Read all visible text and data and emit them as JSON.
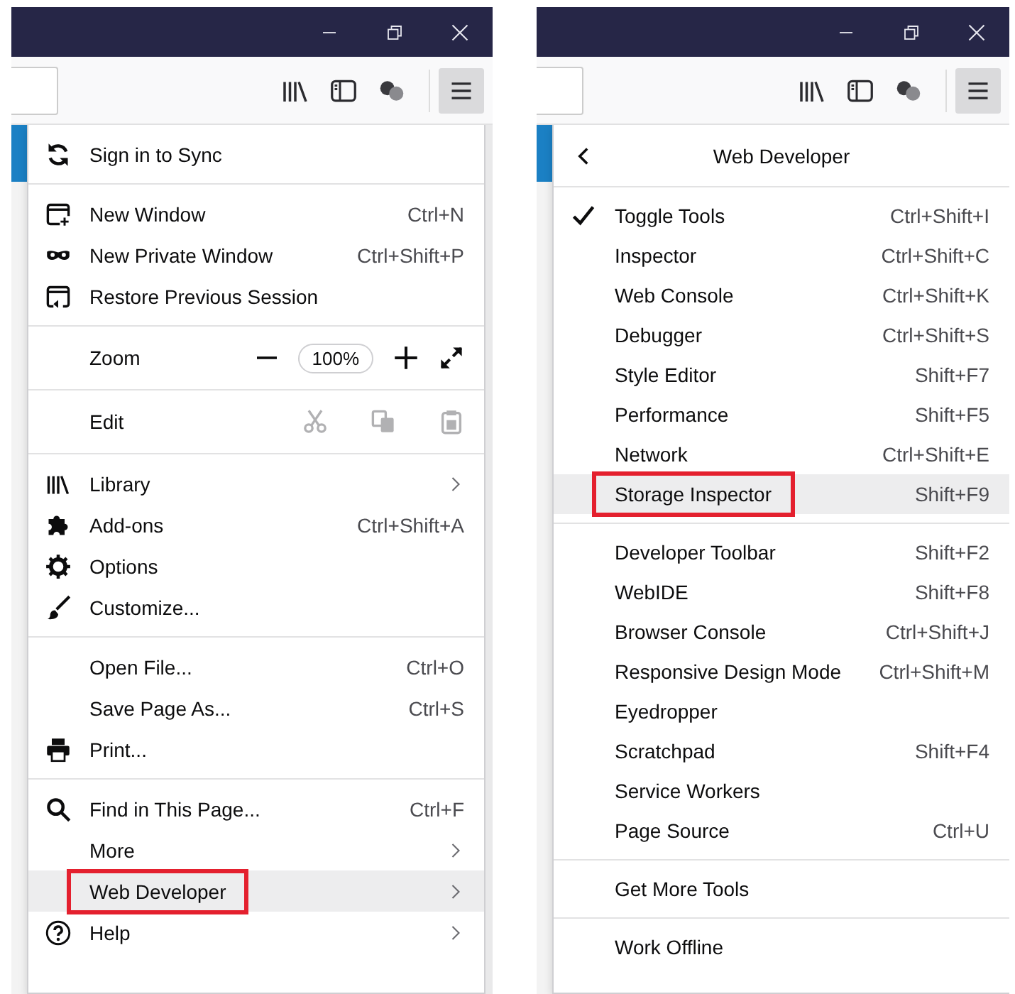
{
  "panels": [
    {
      "kind": "main",
      "sections": [
        {
          "items": [
            {
              "kind": "item",
              "label": "Sign in to Sync",
              "selected": false,
              "annotated": false,
              "submenu": false
            }
          ]
        },
        {
          "items": [
            {
              "kind": "item",
              "label": "New Window",
              "shortcut": "Ctrl+N",
              "selected": false,
              "annotated": false,
              "submenu": false
            },
            {
              "kind": "item",
              "label": "New Private Window",
              "shortcut": "Ctrl+Shift+P",
              "selected": false,
              "annotated": false,
              "submenu": false
            },
            {
              "kind": "item",
              "label": "Restore Previous Session",
              "selected": false,
              "annotated": false,
              "submenu": false
            }
          ]
        },
        {
          "items": [
            {
              "kind": "zoom",
              "label": "Zoom",
              "value": "100%"
            }
          ]
        },
        {
          "items": [
            {
              "kind": "edit",
              "label": "Edit",
              "disabled": true
            }
          ]
        },
        {
          "items": [
            {
              "kind": "item",
              "label": "Library",
              "selected": false,
              "annotated": false,
              "submenu": true
            },
            {
              "kind": "item",
              "label": "Add-ons",
              "shortcut": "Ctrl+Shift+A",
              "selected": false,
              "annotated": false,
              "submenu": false
            },
            {
              "kind": "item",
              "label": "Options",
              "selected": false,
              "annotated": false,
              "submenu": false
            },
            {
              "kind": "item",
              "label": "Customize...",
              "selected": false,
              "annotated": false,
              "submenu": false
            }
          ]
        },
        {
          "items": [
            {
              "kind": "item",
              "label": "Open File...",
              "shortcut": "Ctrl+O",
              "selected": false,
              "annotated": false,
              "submenu": false
            },
            {
              "kind": "item",
              "label": "Save Page As...",
              "shortcut": "Ctrl+S",
              "selected": false,
              "annotated": false,
              "submenu": false
            },
            {
              "kind": "item",
              "label": "Print...",
              "selected": false,
              "annotated": false,
              "submenu": false
            }
          ]
        },
        {
          "items": [
            {
              "kind": "item",
              "label": "Find in This Page...",
              "shortcut": "Ctrl+F",
              "selected": false,
              "annotated": false,
              "submenu": false
            },
            {
              "kind": "item",
              "label": "More",
              "selected": false,
              "annotated": false,
              "submenu": true
            },
            {
              "kind": "item",
              "label": "Web Developer",
              "selected": true,
              "annotated": true,
              "submenu": true
            },
            {
              "kind": "item",
              "label": "Help",
              "selected": false,
              "annotated": false,
              "submenu": true
            }
          ]
        }
      ]
    },
    {
      "kind": "submenu",
      "title": "Web Developer",
      "sections": [
        {
          "items": [
            {
              "kind": "item",
              "label": "Toggle Tools",
              "shortcut": "Ctrl+Shift+I",
              "checked": true,
              "selected": false,
              "annotated": false,
              "submenu": false
            },
            {
              "kind": "item",
              "label": "Inspector",
              "shortcut": "Ctrl+Shift+C",
              "checked": false,
              "selected": false,
              "annotated": false,
              "submenu": false
            },
            {
              "kind": "item",
              "label": "Web Console",
              "shortcut": "Ctrl+Shift+K",
              "checked": false,
              "selected": false,
              "annotated": false,
              "submenu": false
            },
            {
              "kind": "item",
              "label": "Debugger",
              "shortcut": "Ctrl+Shift+S",
              "checked": false,
              "selected": false,
              "annotated": false,
              "submenu": false
            },
            {
              "kind": "item",
              "label": "Style Editor",
              "shortcut": "Shift+F7",
              "checked": false,
              "selected": false,
              "annotated": false,
              "submenu": false
            },
            {
              "kind": "item",
              "label": "Performance",
              "shortcut": "Shift+F5",
              "checked": false,
              "selected": false,
              "annotated": false,
              "submenu": false
            },
            {
              "kind": "item",
              "label": "Network",
              "shortcut": "Ctrl+Shift+E",
              "checked": false,
              "selected": false,
              "annotated": false,
              "submenu": false
            },
            {
              "kind": "item",
              "label": "Storage Inspector",
              "shortcut": "Shift+F9",
              "checked": false,
              "selected": true,
              "annotated": true,
              "submenu": false
            }
          ]
        },
        {
          "items": [
            {
              "kind": "item",
              "label": "Developer Toolbar",
              "shortcut": "Shift+F2",
              "checked": false,
              "selected": false,
              "annotated": false,
              "submenu": false
            },
            {
              "kind": "item",
              "label": "WebIDE",
              "shortcut": "Shift+F8",
              "checked": false,
              "selected": false,
              "annotated": false,
              "submenu": false
            },
            {
              "kind": "item",
              "label": "Browser Console",
              "shortcut": "Ctrl+Shift+J",
              "checked": false,
              "selected": false,
              "annotated": false,
              "submenu": false
            },
            {
              "kind": "item",
              "label": "Responsive Design Mode",
              "shortcut": "Ctrl+Shift+M",
              "checked": false,
              "selected": false,
              "annotated": false,
              "submenu": false
            },
            {
              "kind": "item",
              "label": "Eyedropper",
              "checked": false,
              "selected": false,
              "annotated": false,
              "submenu": false
            },
            {
              "kind": "item",
              "label": "Scratchpad",
              "shortcut": "Shift+F4",
              "checked": false,
              "selected": false,
              "annotated": false,
              "submenu": false
            },
            {
              "kind": "item",
              "label": "Service Workers",
              "checked": false,
              "selected": false,
              "annotated": false,
              "submenu": false
            },
            {
              "kind": "item",
              "label": "Page Source",
              "shortcut": "Ctrl+U",
              "checked": false,
              "selected": false,
              "annotated": false,
              "submenu": false
            }
          ]
        },
        {
          "items": [
            {
              "kind": "item",
              "label": "Get More Tools",
              "checked": false,
              "selected": false,
              "annotated": false,
              "submenu": false
            }
          ]
        },
        {
          "items": [
            {
              "kind": "item",
              "label": "Work Offline",
              "checked": false,
              "selected": false,
              "annotated": false,
              "submenu": false
            }
          ]
        }
      ]
    }
  ]
}
